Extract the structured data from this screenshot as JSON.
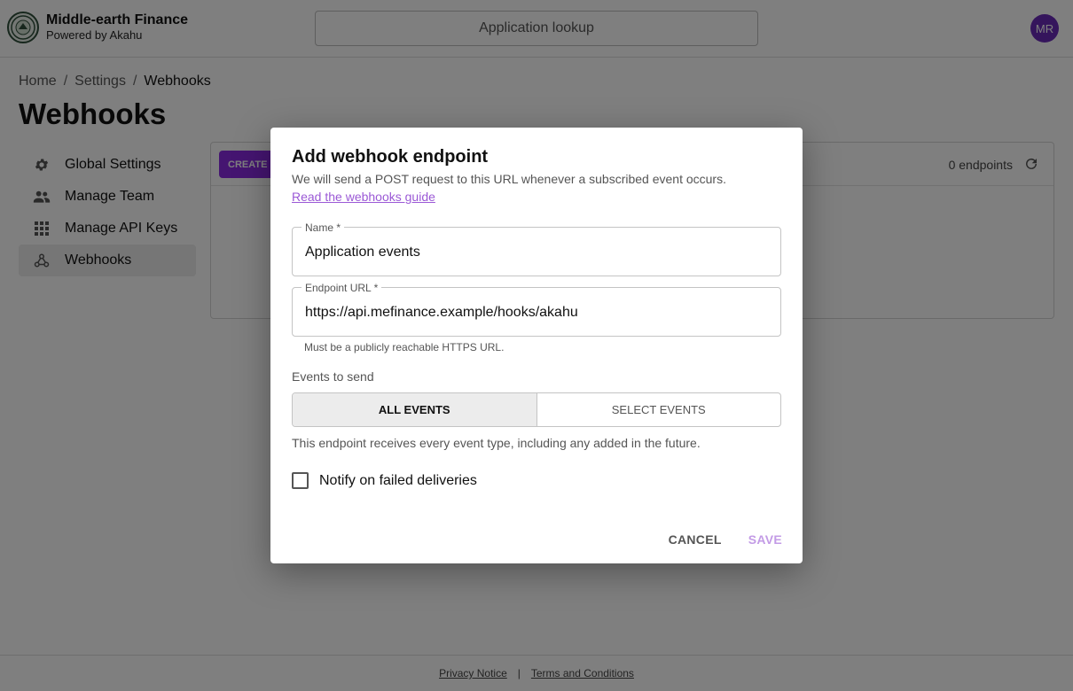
{
  "header": {
    "brand_title": "Middle-earth Finance",
    "brand_sub": "Powered by Akahu",
    "lookup_label": "Application lookup",
    "avatar_initials": "MR"
  },
  "breadcrumb": {
    "home": "Home",
    "settings": "Settings",
    "current": "Webhooks",
    "separator": "/"
  },
  "page": {
    "title": "Webhooks"
  },
  "sidebar": {
    "items": [
      {
        "label": "Global Settings",
        "icon": "gear-icon"
      },
      {
        "label": "Manage Team",
        "icon": "people-icon"
      },
      {
        "label": "Manage API Keys",
        "icon": "grid-icon"
      },
      {
        "label": "Webhooks",
        "icon": "webhook-icon",
        "active": true
      }
    ]
  },
  "panel": {
    "create_label": "CREATE",
    "count_label": "0 endpoints"
  },
  "footer": {
    "privacy": "Privacy Notice",
    "separator": "|",
    "terms": "Terms and Conditions"
  },
  "dialog": {
    "title": "Add webhook endpoint",
    "description": "We will send a POST request to this URL whenever a subscribed event occurs.",
    "guide_link": "Read the webhooks guide",
    "name_label": "Name *",
    "name_value": "Application events",
    "url_label": "Endpoint URL *",
    "url_value": "https://api.mefinance.example/hooks/akahu",
    "url_helper": "Must be a publicly reachable HTTPS URL.",
    "events_label": "Events to send",
    "all_events": "ALL EVENTS",
    "select_events": "SELECT EVENTS",
    "events_desc": "This endpoint receives every event type, including any added in the future.",
    "notify_label": "Notify on failed deliveries",
    "cancel": "CANCEL",
    "save": "SAVE"
  },
  "colors": {
    "accent": "#8a2be2",
    "avatar": "#6a2bb8",
    "link": "#9b59d6",
    "save_disabled": "#c39be6"
  }
}
